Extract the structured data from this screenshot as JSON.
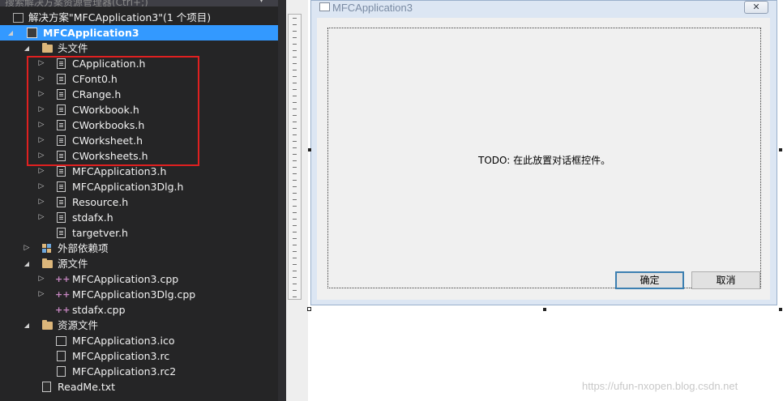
{
  "solution_explorer": {
    "topbar_text": "搜索解决方案资源管理器(Ctrl+;)",
    "collapse_glyph": "▾",
    "items": [
      {
        "label": "解决方案\"MFCApplication3\"(1 个项目)",
        "icon": "solution-icon",
        "expander": ""
      },
      {
        "label": "MFCApplication3",
        "icon": "project-icon",
        "expander": "◢"
      },
      {
        "label": "头文件",
        "icon": "folder-icon",
        "expander": "◢"
      },
      {
        "label": "CApplication.h",
        "icon": "header-file-icon",
        "expander": "▷"
      },
      {
        "label": "CFont0.h",
        "icon": "header-file-icon",
        "expander": "▷"
      },
      {
        "label": "CRange.h",
        "icon": "header-file-icon",
        "expander": "▷"
      },
      {
        "label": "CWorkbook.h",
        "icon": "header-file-icon",
        "expander": "▷"
      },
      {
        "label": "CWorkbooks.h",
        "icon": "header-file-icon",
        "expander": "▷"
      },
      {
        "label": "CWorksheet.h",
        "icon": "header-file-icon",
        "expander": "▷"
      },
      {
        "label": "CWorksheets.h",
        "icon": "header-file-icon",
        "expander": "▷"
      },
      {
        "label": "MFCApplication3.h",
        "icon": "header-file-icon",
        "expander": "▷"
      },
      {
        "label": "MFCApplication3Dlg.h",
        "icon": "header-file-icon",
        "expander": "▷"
      },
      {
        "label": "Resource.h",
        "icon": "header-file-icon",
        "expander": "▷"
      },
      {
        "label": "stdafx.h",
        "icon": "header-file-icon",
        "expander": "▷"
      },
      {
        "label": "targetver.h",
        "icon": "header-file-icon",
        "expander": ""
      },
      {
        "label": "外部依赖项",
        "icon": "external-deps-icon",
        "expander": "▷"
      },
      {
        "label": "源文件",
        "icon": "folder-icon",
        "expander": "◢"
      },
      {
        "label": "MFCApplication3.cpp",
        "icon": "cpp-file-icon",
        "expander": "▷"
      },
      {
        "label": "MFCApplication3Dlg.cpp",
        "icon": "cpp-file-icon",
        "expander": "▷"
      },
      {
        "label": "stdafx.cpp",
        "icon": "cpp-file-icon",
        "expander": ""
      },
      {
        "label": "资源文件",
        "icon": "folder-icon",
        "expander": "◢"
      },
      {
        "label": "MFCApplication3.ico",
        "icon": "ico-file-icon",
        "expander": ""
      },
      {
        "label": "MFCApplication3.rc",
        "icon": "rc-file-icon",
        "expander": ""
      },
      {
        "label": "MFCApplication3.rc2",
        "icon": "rc-file-icon",
        "expander": ""
      },
      {
        "label": "ReadMe.txt",
        "icon": "text-file-icon",
        "expander": ""
      }
    ]
  },
  "dialog": {
    "title": "MFCApplication3",
    "close_glyph": "✕",
    "todo_text": "TODO:  在此放置对话框控件。",
    "ok_label": "确定",
    "cancel_label": "取消"
  },
  "watermark": "https://ufun-nxopen.blog.csdn.net",
  "colors": {
    "selection": "#3399ff",
    "highlight_box": "#e02020",
    "explorer_bg": "#252526"
  }
}
